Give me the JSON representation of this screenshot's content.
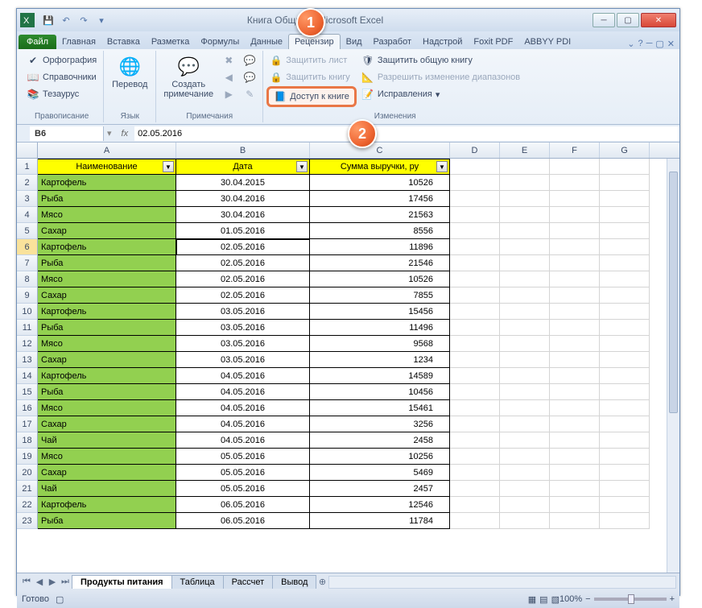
{
  "window": {
    "title": "Книга        Общий]  -  Microsoft Excel"
  },
  "qat": {
    "save": "💾",
    "undo": "↶",
    "redo": "↷"
  },
  "tabs": {
    "file": "Файл",
    "items": [
      "Главная",
      "Вставка",
      "Разметка",
      "Формулы",
      "Данные",
      "Рецензир",
      "Вид",
      "Разработ",
      "Надстрой",
      "Foxit PDF",
      "ABBYY PDI"
    ],
    "active": "Рецензир"
  },
  "ribbon": {
    "proofing": {
      "label": "Правописание",
      "spell": "Орфография",
      "ref": "Справочники",
      "thes": "Тезаурус"
    },
    "lang": {
      "label": "Язык",
      "btn": "Перевод"
    },
    "comments": {
      "label": "Примечания",
      "btn": "Создать примечание"
    },
    "changes": {
      "label": "Изменения",
      "protect_sheet": "Защитить лист",
      "protect_book": "Защитить книгу",
      "share": "Доступ к книге",
      "protect_shared": "Защитить общую книгу",
      "allow_ranges": "Разрешить изменение диапазонов",
      "track": "Исправления"
    }
  },
  "namebox": "B6",
  "formula": "02.05.2016",
  "columns": [
    "A",
    "B",
    "C",
    "D",
    "E",
    "F",
    "G"
  ],
  "headers": {
    "a": "Наименование",
    "b": "Дата",
    "c": "Сумма выручки, ру"
  },
  "rows": [
    {
      "n": 2,
      "a": "Картофель",
      "b": "30.04.2015",
      "c": "10526"
    },
    {
      "n": 3,
      "a": "Рыба",
      "b": "30.04.2016",
      "c": "17456"
    },
    {
      "n": 4,
      "a": "Мясо",
      "b": "30.04.2016",
      "c": "21563"
    },
    {
      "n": 5,
      "a": "Сахар",
      "b": "01.05.2016",
      "c": "8556"
    },
    {
      "n": 6,
      "a": "Картофель",
      "b": "02.05.2016",
      "c": "11896"
    },
    {
      "n": 7,
      "a": "Рыба",
      "b": "02.05.2016",
      "c": "21546"
    },
    {
      "n": 8,
      "a": "Мясо",
      "b": "02.05.2016",
      "c": "10526"
    },
    {
      "n": 9,
      "a": "Сахар",
      "b": "02.05.2016",
      "c": "7855"
    },
    {
      "n": 10,
      "a": "Картофель",
      "b": "03.05.2016",
      "c": "15456"
    },
    {
      "n": 11,
      "a": "Рыба",
      "b": "03.05.2016",
      "c": "11496"
    },
    {
      "n": 12,
      "a": "Мясо",
      "b": "03.05.2016",
      "c": "9568"
    },
    {
      "n": 13,
      "a": "Сахар",
      "b": "03.05.2016",
      "c": "1234"
    },
    {
      "n": 14,
      "a": "Картофель",
      "b": "04.05.2016",
      "c": "14589"
    },
    {
      "n": 15,
      "a": "Рыба",
      "b": "04.05.2016",
      "c": "10456"
    },
    {
      "n": 16,
      "a": "Мясо",
      "b": "04.05.2016",
      "c": "15461"
    },
    {
      "n": 17,
      "a": "Сахар",
      "b": "04.05.2016",
      "c": "3256"
    },
    {
      "n": 18,
      "a": "Чай",
      "b": "04.05.2016",
      "c": "2458"
    },
    {
      "n": 19,
      "a": "Мясо",
      "b": "05.05.2016",
      "c": "10256"
    },
    {
      "n": 20,
      "a": "Сахар",
      "b": "05.05.2016",
      "c": "5469"
    },
    {
      "n": 21,
      "a": "Чай",
      "b": "05.05.2016",
      "c": "2457"
    },
    {
      "n": 22,
      "a": "Картофель",
      "b": "06.05.2016",
      "c": "12546"
    },
    {
      "n": 23,
      "a": "Рыба",
      "b": "06.05.2016",
      "c": "11784"
    }
  ],
  "sheets": {
    "active": "Продукты питания",
    "others": [
      "Таблица",
      "Рассчет",
      "Вывод"
    ]
  },
  "status": {
    "ready": "Готово",
    "zoom": "100%"
  },
  "callouts": {
    "one": "1",
    "two": "2"
  }
}
